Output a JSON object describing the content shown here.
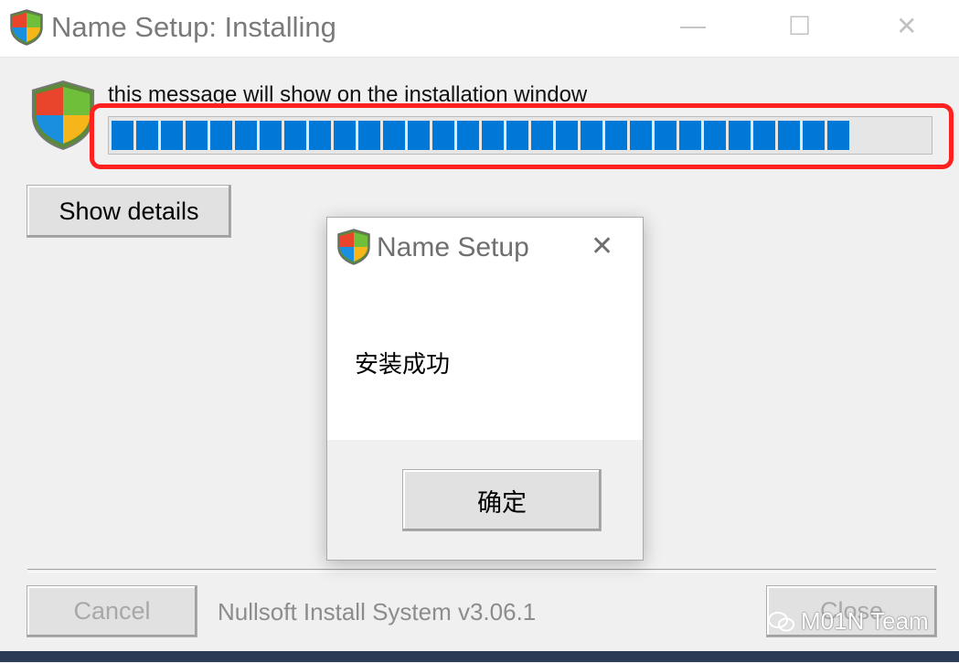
{
  "window": {
    "title": "Name Setup: Installing",
    "minimize_glyph": "—",
    "maximize_glyph": "☐",
    "close_glyph": "✕"
  },
  "install": {
    "message": "this message will show on the installation window",
    "progress_percent": 91,
    "show_details_label": "Show details",
    "cancel_label": "Cancel",
    "close_label": "Close",
    "branding": "Nullsoft Install System v3.06.1"
  },
  "dialog": {
    "title": "Name Setup",
    "close_glyph": "✕",
    "message": "安装成功",
    "ok_label": "确定"
  },
  "watermark": {
    "text": "M01N Team"
  },
  "colors": {
    "progress": "#0078d7",
    "highlight": "#ff2020"
  },
  "icons": [
    "shield-icon",
    "wechat-icon"
  ]
}
